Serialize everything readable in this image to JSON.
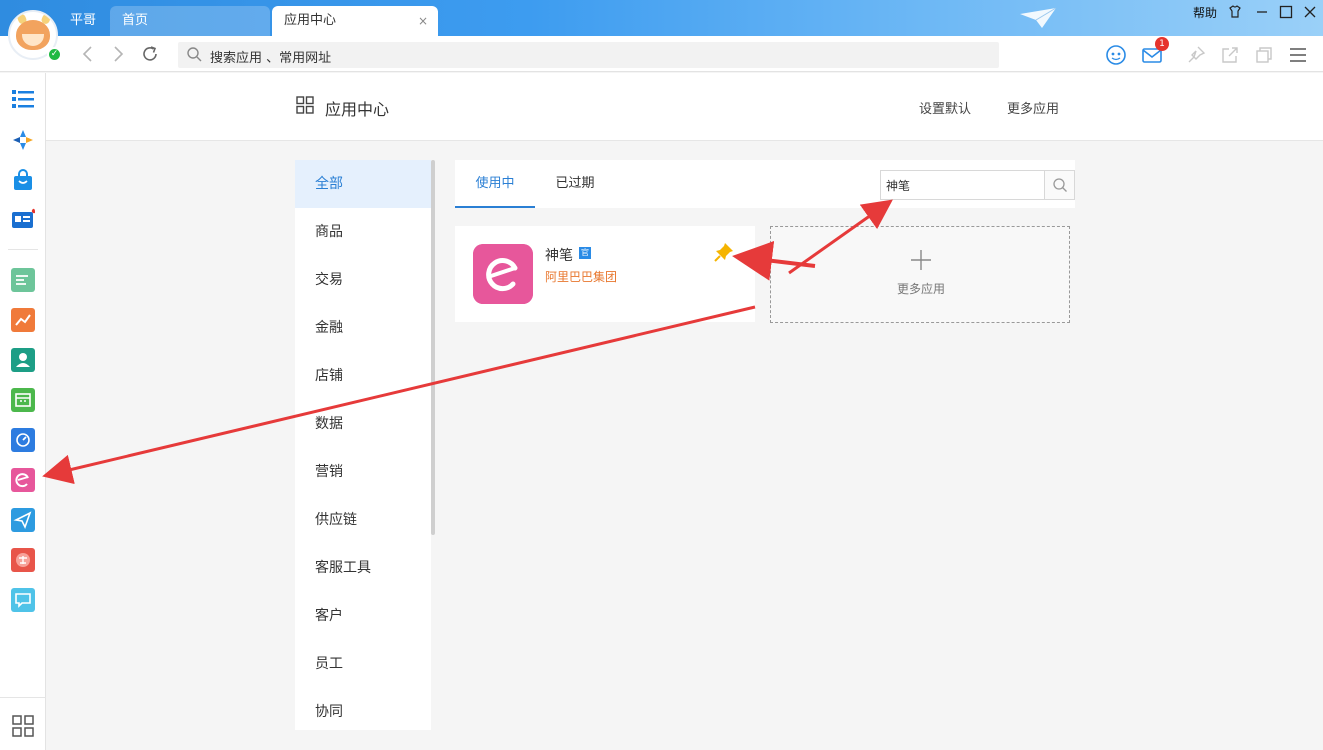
{
  "tabs": {
    "pingge": "平哥",
    "home": "首页",
    "active": "应用中心",
    "close": "×"
  },
  "window": {
    "help": "帮助"
  },
  "address": {
    "placeholder": "搜索应用 、常用网址"
  },
  "mail_badge": "1",
  "page": {
    "title": "应用中心",
    "set_default": "设置默认",
    "more_apps": "更多应用"
  },
  "categories": [
    "全部",
    "商品",
    "交易",
    "金融",
    "店铺",
    "数据",
    "营销",
    "供应链",
    "客服工具",
    "客户",
    "员工",
    "协同"
  ],
  "panel": {
    "tab_in_use": "使用中",
    "tab_expired": "已过期",
    "search_value": "神笔"
  },
  "app": {
    "name": "神笔",
    "badge": "官",
    "vendor": "阿里巴巴集团"
  },
  "more_card": {
    "label": "更多应用"
  },
  "colors": {
    "accent": "#2a7fd4",
    "vendor": "#e8772e",
    "app_logo": "#e7579b",
    "annotation": "#e63a3a"
  }
}
